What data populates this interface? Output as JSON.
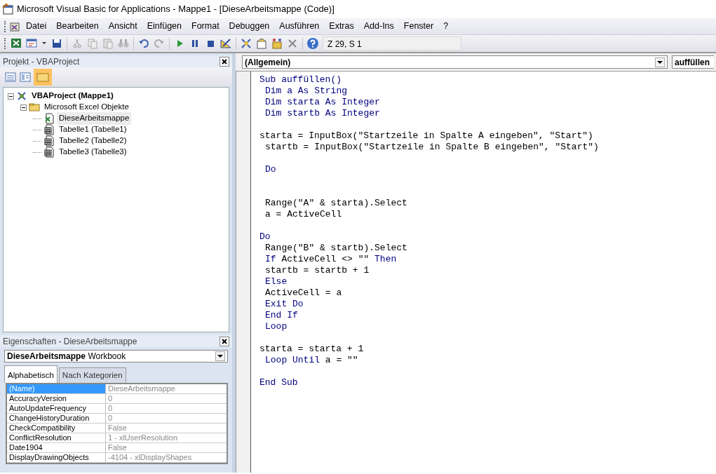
{
  "window": {
    "title": "Microsoft Visual Basic for Applications - Mappe1 - [DieseArbeitsmappe (Code)]"
  },
  "menu": [
    "Datei",
    "Bearbeiten",
    "Ansicht",
    "Einfügen",
    "Format",
    "Debuggen",
    "Ausführen",
    "Extras",
    "Add-Ins",
    "Fenster",
    "?"
  ],
  "toolbar": {
    "position": "Z 29, S 1"
  },
  "project_panel": {
    "title": "Projekt - VBAProject",
    "tree": [
      {
        "label": "VBAProject (Mappe1)",
        "kind": "project",
        "expanded": true,
        "selected": false,
        "children": [
          {
            "label": "Microsoft Excel Objekte",
            "kind": "folder",
            "expanded": true,
            "selected": false,
            "children": [
              {
                "label": "DieseArbeitsmappe",
                "kind": "workbook",
                "selected": true
              },
              {
                "label": "Tabelle1 (Tabelle1)",
                "kind": "sheet",
                "selected": false
              },
              {
                "label": "Tabelle2 (Tabelle2)",
                "kind": "sheet",
                "selected": false
              },
              {
                "label": "Tabelle3 (Tabelle3)",
                "kind": "sheet",
                "selected": false
              }
            ]
          }
        ]
      }
    ]
  },
  "properties_panel": {
    "title": "Eigenschaften - DieseArbeitsmappe",
    "object_name": "DieseArbeitsmappe",
    "object_type": "Workbook",
    "tabs": [
      {
        "label": "Alphabetisch",
        "selected": true
      },
      {
        "label": "Nach Kategorien",
        "selected": false
      }
    ],
    "rows": [
      {
        "name": "(Name)",
        "value": "DieseArbeitsmappe",
        "selected": true
      },
      {
        "name": "AccuracyVersion",
        "value": "0",
        "selected": false
      },
      {
        "name": "AutoUpdateFrequency",
        "value": "0",
        "selected": false
      },
      {
        "name": "ChangeHistoryDuration",
        "value": "0",
        "selected": false
      },
      {
        "name": "CheckCompatibility",
        "value": "False",
        "selected": false
      },
      {
        "name": "ConflictResolution",
        "value": "1 - xlUserResolution",
        "selected": false
      },
      {
        "name": "Date1904",
        "value": "False",
        "selected": false
      },
      {
        "name": "DisplayDrawingObjects",
        "value": "-4104 - xlDisplayShapes",
        "selected": false
      }
    ]
  },
  "code_window": {
    "object_combo": "(Allgemein)",
    "procedure_combo": "auffüllen",
    "lines": [
      {
        "kind": "code",
        "indented": false,
        "tokens": [
          {
            "text": "Sub auffüllen()",
            "kind": "keyword"
          }
        ]
      },
      {
        "kind": "code",
        "indented": true,
        "tokens": [
          {
            "text": "Dim a As String",
            "kind": "keyword"
          }
        ]
      },
      {
        "kind": "code",
        "indented": true,
        "tokens": [
          {
            "text": "Dim starta As Integer",
            "kind": "keyword"
          }
        ]
      },
      {
        "kind": "code",
        "indented": true,
        "tokens": [
          {
            "text": "Dim startb As Integer",
            "kind": "keyword"
          }
        ]
      },
      {
        "kind": "blank"
      },
      {
        "kind": "code",
        "indented": false,
        "tokens": [
          {
            "text": "starta = InputBox(\"Startzeile in Spalte A eingeben\", \"Start\")",
            "kind": "plain"
          }
        ]
      },
      {
        "kind": "code",
        "indented": true,
        "tokens": [
          {
            "text": "startb = InputBox(\"Startzeile in Spalte B eingeben\", \"Start\")",
            "kind": "plain"
          }
        ]
      },
      {
        "kind": "blank"
      },
      {
        "kind": "code",
        "indented": true,
        "tokens": [
          {
            "text": "Do",
            "kind": "keyword"
          }
        ]
      },
      {
        "kind": "blank"
      },
      {
        "kind": "blank"
      },
      {
        "kind": "code",
        "indented": true,
        "tokens": [
          {
            "text": "Range(\"A\" & starta).Select",
            "kind": "plain"
          }
        ]
      },
      {
        "kind": "code",
        "indented": true,
        "tokens": [
          {
            "text": "a = ActiveCell",
            "kind": "plain"
          }
        ]
      },
      {
        "kind": "blank"
      },
      {
        "kind": "code",
        "indented": false,
        "tokens": [
          {
            "text": "Do",
            "kind": "keyword"
          }
        ]
      },
      {
        "kind": "code",
        "indented": true,
        "tokens": [
          {
            "text": "Range(\"B\" & startb).Select",
            "kind": "plain"
          }
        ]
      },
      {
        "kind": "code",
        "indented": true,
        "tokens": [
          {
            "text": "If",
            "kind": "keyword"
          },
          {
            "text": " ActiveCell <> \"\" ",
            "kind": "plain"
          },
          {
            "text": "Then",
            "kind": "keyword"
          }
        ]
      },
      {
        "kind": "code",
        "indented": true,
        "tokens": [
          {
            "text": "startb = startb + 1",
            "kind": "plain"
          }
        ]
      },
      {
        "kind": "code",
        "indented": true,
        "tokens": [
          {
            "text": "Else",
            "kind": "keyword"
          }
        ]
      },
      {
        "kind": "code",
        "indented": true,
        "tokens": [
          {
            "text": "ActiveCell = a",
            "kind": "plain"
          }
        ]
      },
      {
        "kind": "code",
        "indented": true,
        "tokens": [
          {
            "text": "Exit Do",
            "kind": "keyword"
          }
        ]
      },
      {
        "kind": "code",
        "indented": true,
        "tokens": [
          {
            "text": "End If",
            "kind": "keyword"
          }
        ]
      },
      {
        "kind": "code",
        "indented": true,
        "tokens": [
          {
            "text": "Loop",
            "kind": "keyword"
          }
        ]
      },
      {
        "kind": "blank"
      },
      {
        "kind": "code",
        "indented": false,
        "tokens": [
          {
            "text": "starta = starta + 1",
            "kind": "plain"
          }
        ]
      },
      {
        "kind": "code",
        "indented": true,
        "tokens": [
          {
            "text": "Loop Until",
            "kind": "keyword"
          },
          {
            "text": " a = \"\"",
            "kind": "plain"
          }
        ]
      },
      {
        "kind": "blank"
      },
      {
        "kind": "code",
        "indented": false,
        "tokens": [
          {
            "text": "End Sub",
            "kind": "keyword"
          }
        ]
      }
    ]
  }
}
